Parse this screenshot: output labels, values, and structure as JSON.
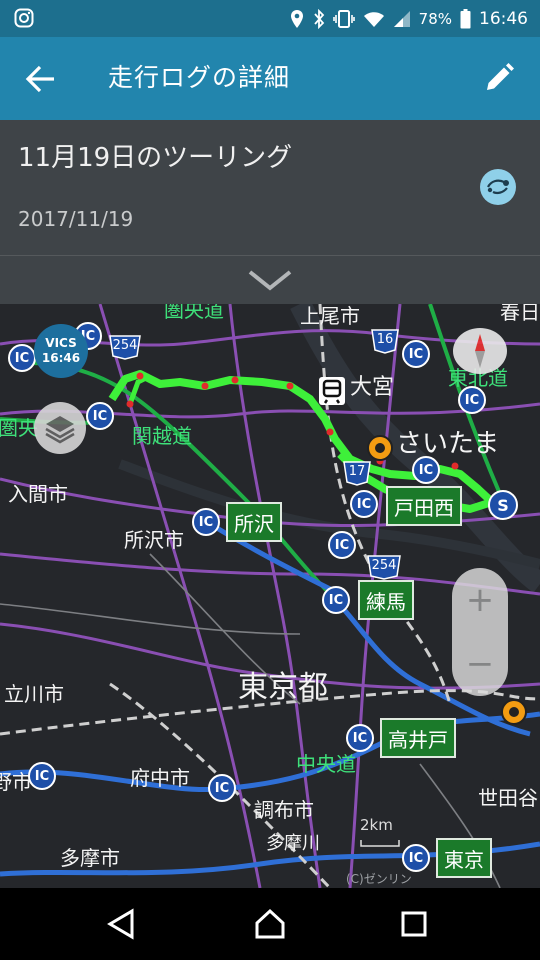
{
  "status_bar": {
    "battery": "78%",
    "time": "16:46"
  },
  "app_bar": {
    "title": "走行ログの詳細"
  },
  "trip": {
    "name": "11月19日のツーリング",
    "date": "2017/11/19"
  },
  "map": {
    "vics": {
      "label": "VICS",
      "time": "16:46"
    },
    "place_labels": {
      "kenodo": "圏央道",
      "ageo": "上尾市",
      "kasukabe": "春日",
      "kenoh2": "圏央",
      "omiya": "大宮",
      "tohoku": "東北道",
      "kanetsu": "関越道",
      "saitama": "さいたま",
      "iruma": "入間市",
      "tokorozawa_city": "所沢市",
      "tokyo": "東京都",
      "tachikawa": "立川市",
      "chuo": "中央道",
      "fuchu": "府中市",
      "chofu": "調布市",
      "setagaya": "世田谷",
      "tama_city": "多摩市",
      "tamagawa": "多摩川",
      "musashino": "野市"
    },
    "ic_label": "IC",
    "ramps": {
      "tokorozawa": "所沢",
      "todanishi": "戸田西",
      "nerima": "練馬",
      "takaido": "高井戸",
      "tokyo_ic": "東京"
    },
    "route_numbers": {
      "r254a": "254",
      "r16": "16",
      "r17": "17",
      "r254b": "254"
    },
    "start_marker": "S",
    "scale": "2km",
    "copyright": "(C)ゼンリン",
    "zoom_in": "+",
    "zoom_out": "−"
  },
  "colors": {
    "accent": "#2285ad",
    "status": "#1d6f8e",
    "route": "#3ef03a",
    "ic": "#1e4fa8"
  }
}
